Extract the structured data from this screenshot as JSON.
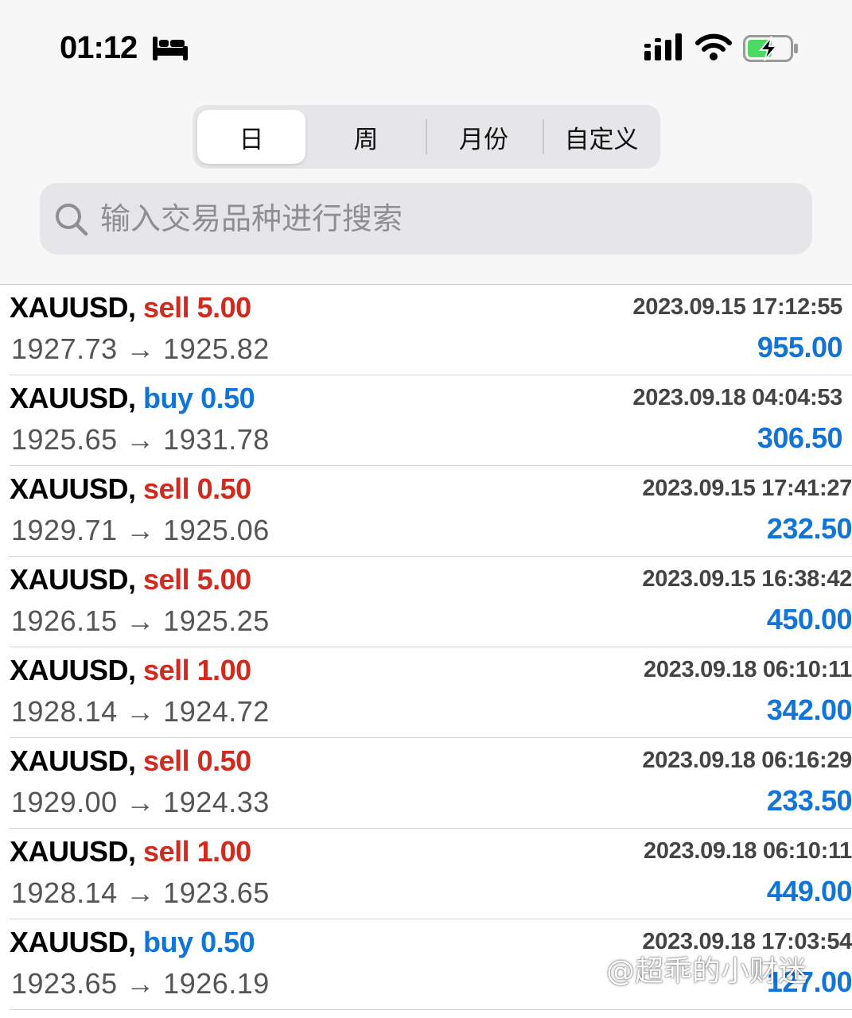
{
  "status_bar": {
    "time": "01:12",
    "focus_icon": "bed-icon",
    "signal_icon": "signal-icon",
    "wifi_icon": "wifi-icon",
    "battery_icon": "battery-charging-icon",
    "battery_color": "#4cd964"
  },
  "period_tabs": {
    "items": [
      {
        "label": "日",
        "active": true
      },
      {
        "label": "周",
        "active": false
      },
      {
        "label": "月份",
        "active": false
      },
      {
        "label": "自定义",
        "active": false
      }
    ]
  },
  "search": {
    "placeholder": "输入交易品种进行搜索"
  },
  "colors": {
    "sell": "#d12b1f",
    "buy": "#1174d8",
    "profit": "#1174d8"
  },
  "trades": [
    {
      "symbol": "XAUUSD,",
      "side": "sell",
      "volume": "5.00",
      "open": "1927.73",
      "close": "1925.82",
      "time": "2023.09.15 17:12:55",
      "profit": "955.00"
    },
    {
      "symbol": "XAUUSD,",
      "side": "buy",
      "volume": "0.50",
      "open": "1925.65",
      "close": "1931.78",
      "time": "2023.09.18 04:04:53",
      "profit": "306.50"
    },
    {
      "symbol": "XAUUSD,",
      "side": "sell",
      "volume": "0.50",
      "open": "1929.71",
      "close": "1925.06",
      "time": "2023.09.15 17:41:27",
      "profit": "232.50"
    },
    {
      "symbol": "XAUUSD,",
      "side": "sell",
      "volume": "5.00",
      "open": "1926.15",
      "close": "1925.25",
      "time": "2023.09.15 16:38:42",
      "profit": "450.00"
    },
    {
      "symbol": "XAUUSD,",
      "side": "sell",
      "volume": "1.00",
      "open": "1928.14",
      "close": "1924.72",
      "time": "2023.09.18 06:10:11",
      "profit": "342.00"
    },
    {
      "symbol": "XAUUSD,",
      "side": "sell",
      "volume": "0.50",
      "open": "1929.00",
      "close": "1924.33",
      "time": "2023.09.18 06:16:29",
      "profit": "233.50"
    },
    {
      "symbol": "XAUUSD,",
      "side": "sell",
      "volume": "1.00",
      "open": "1928.14",
      "close": "1923.65",
      "time": "2023.09.18 06:10:11",
      "profit": "449.00"
    },
    {
      "symbol": "XAUUSD,",
      "side": "buy",
      "volume": "0.50",
      "open": "1923.65",
      "close": "1926.19",
      "time": "2023.09.18 17:03:54",
      "profit": "127.00"
    }
  ],
  "arrow": "→",
  "watermark": "@超乖的小财迷"
}
